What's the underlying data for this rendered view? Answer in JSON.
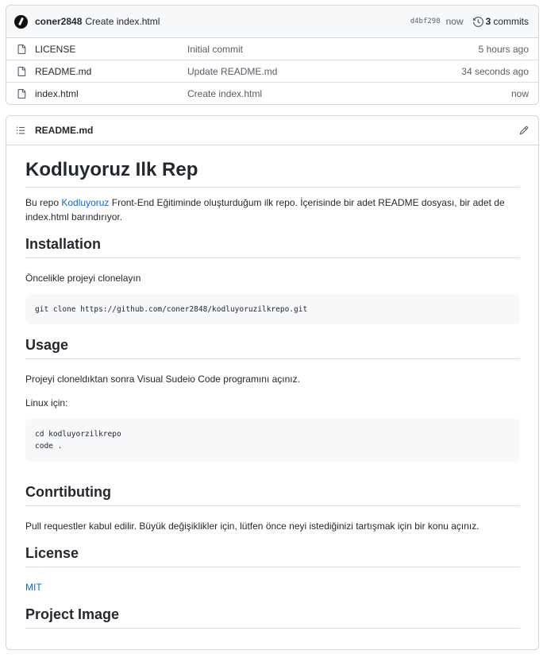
{
  "commit": {
    "author": "coner2848",
    "message": "Create index.html",
    "sha": "d4bf298",
    "time": "now",
    "commits_count": "3",
    "commits_label": "commits"
  },
  "files": [
    {
      "name": "LICENSE",
      "commit": "Initial commit",
      "age": "5 hours ago"
    },
    {
      "name": "README.md",
      "commit": "Update README.md",
      "age": "34 seconds ago"
    },
    {
      "name": "index.html",
      "commit": "Create index.html",
      "age": "now"
    }
  ],
  "readme": {
    "filename": "README.md",
    "h1": "Kodluyoruz Ilk Rep",
    "intro_before": "Bu repo ",
    "intro_link": "Kodluyoruz",
    "intro_after": " Front-End Eğitiminde oluşturduğum ilk repo. İçerisinde bir adet README dosyası, bir adet de index.html barındırıyor.",
    "installation": {
      "heading": "Installation",
      "text": "Öncelikle projeyi clonelayın",
      "code": "git clone https://github.com/coner2848/kodluyoruzilkrepo.git"
    },
    "usage": {
      "heading": "Usage",
      "text": "Projeyi cloneldıktan sonra Visual Sudeio Code programını açınız.",
      "linux": "Linux için:",
      "code_line1": "cd kodluyorzilkrepo",
      "code_line2": "code ."
    },
    "contributing": {
      "heading": "Conrtibuting",
      "text": "Pull requestler kabul edilir. Büyük değişiklikler için, lütfen önce neyi istediğinizi tartışmak için bir konu açınız."
    },
    "license": {
      "heading": "License",
      "link": "MIT"
    },
    "project_image": {
      "heading": "Project Image"
    }
  }
}
